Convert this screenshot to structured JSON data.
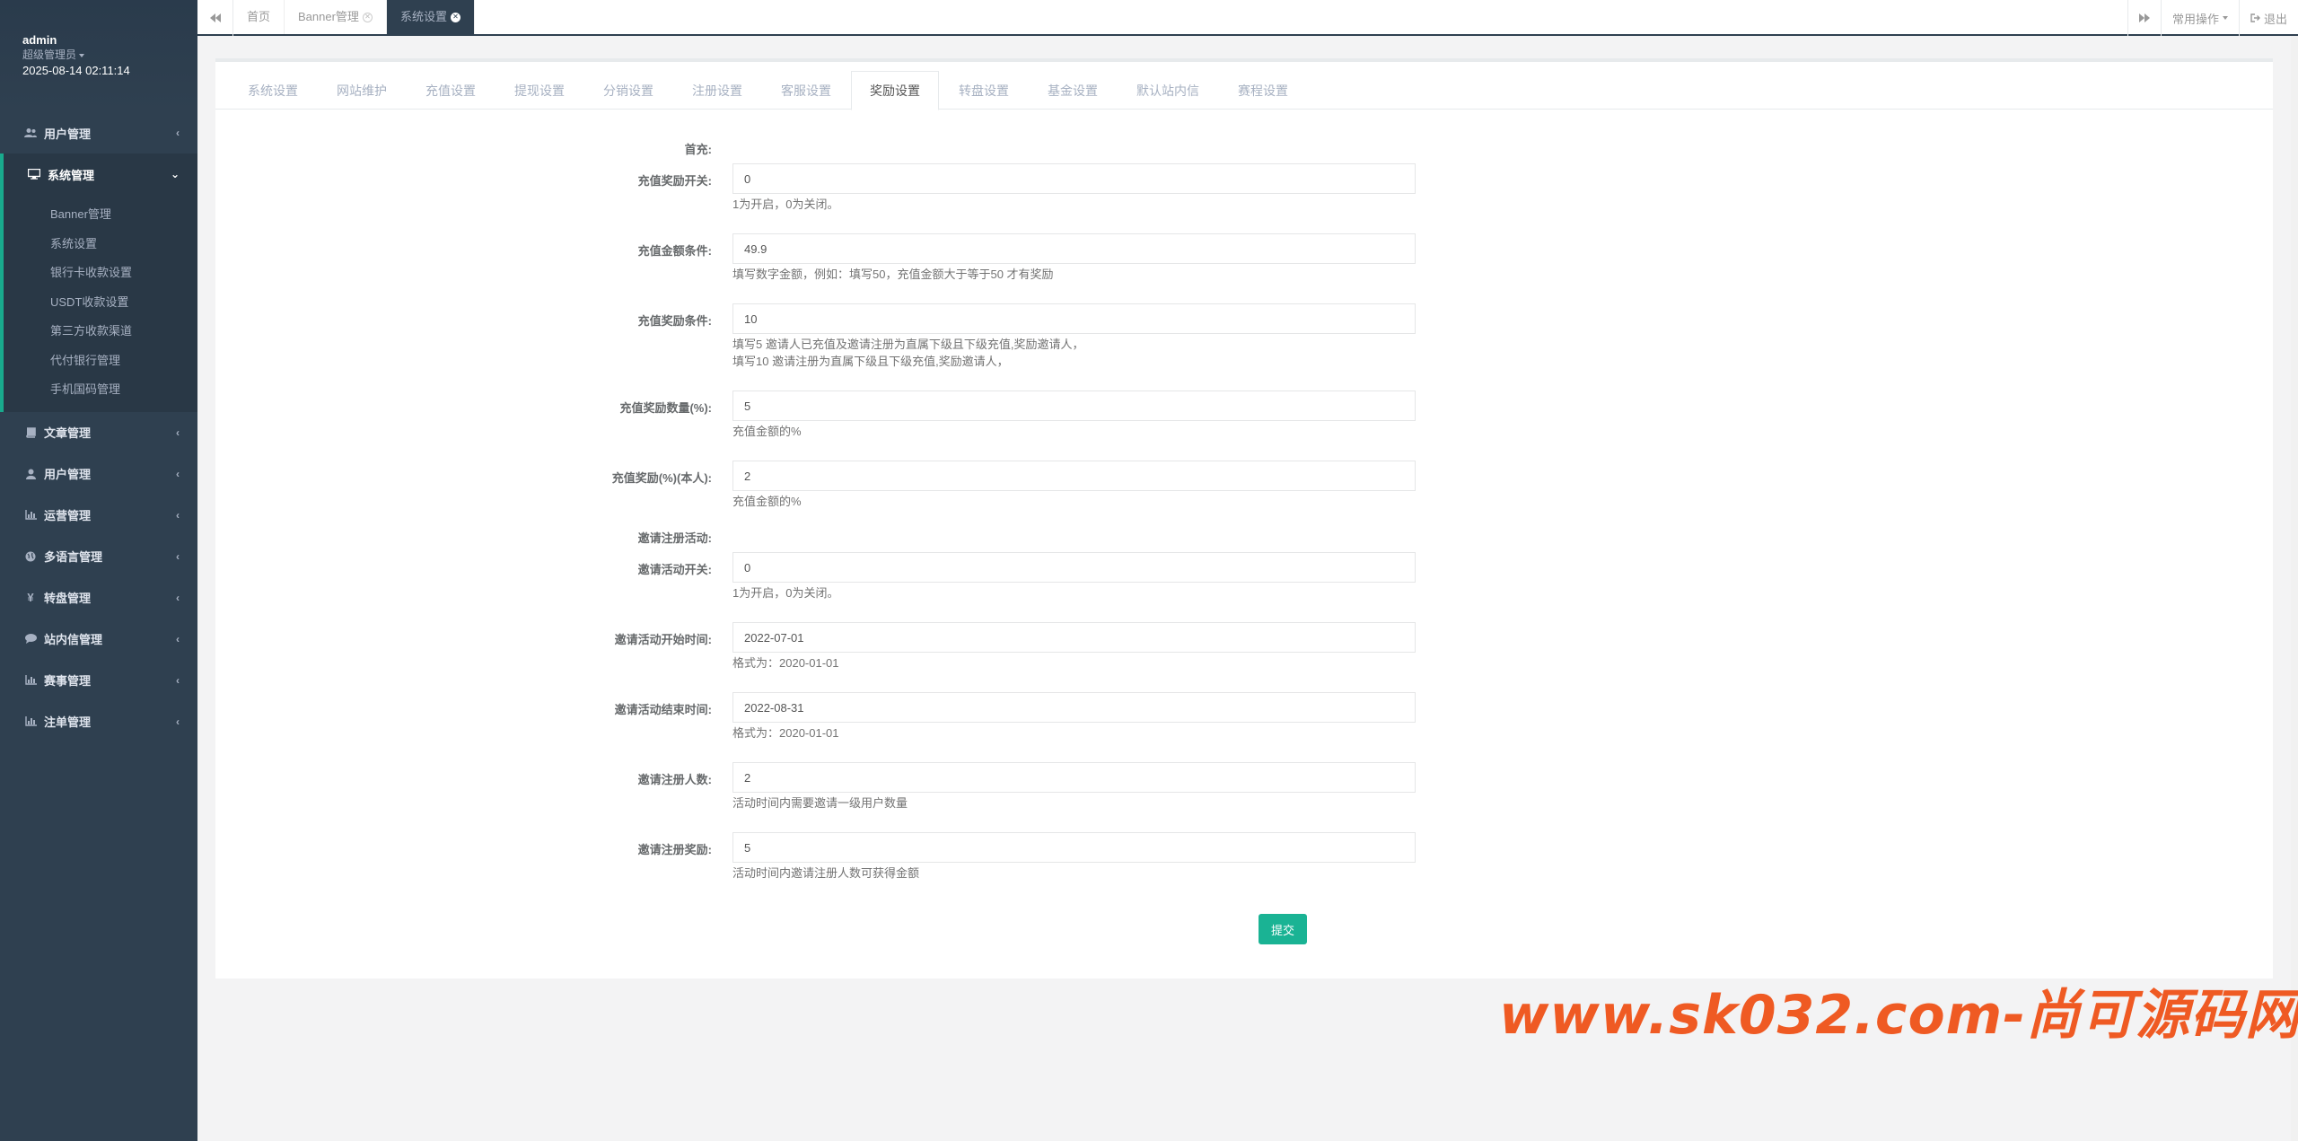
{
  "profile": {
    "name": "admin",
    "role": "超级管理员",
    "datetime": "2025-08-14 02:11:14"
  },
  "sidebar": {
    "items": [
      {
        "label": "用户管理",
        "icon": "users-icon",
        "expanded": false
      },
      {
        "label": "系统管理",
        "icon": "desktop-icon",
        "expanded": true
      },
      {
        "label": "文章管理",
        "icon": "book-icon",
        "expanded": false
      },
      {
        "label": "用户管理",
        "icon": "user-icon",
        "expanded": false
      },
      {
        "label": "运营管理",
        "icon": "bar-chart-icon",
        "expanded": false
      },
      {
        "label": "多语言管理",
        "icon": "globe-icon",
        "expanded": false
      },
      {
        "label": "转盘管理",
        "icon": "yen-icon",
        "expanded": false
      },
      {
        "label": "站内信管理",
        "icon": "comment-icon",
        "expanded": false
      },
      {
        "label": "赛事管理",
        "icon": "bar-chart-icon",
        "expanded": false
      },
      {
        "label": "注单管理",
        "icon": "bar-chart-icon",
        "expanded": false
      }
    ],
    "submenu": [
      "Banner管理",
      "系统设置",
      "银行卡收款设置",
      "USDT收款设置",
      "第三方收款渠道",
      "代付银行管理",
      "手机国码管理"
    ]
  },
  "topbar": {
    "tabs": [
      {
        "label": "首页",
        "closable": false,
        "active": false
      },
      {
        "label": "Banner管理",
        "closable": true,
        "active": false
      },
      {
        "label": "系统设置",
        "closable": true,
        "active": true
      }
    ],
    "common_ops": "常用操作",
    "logout": "退出"
  },
  "settings_tabs": [
    "系统设置",
    "网站维护",
    "充值设置",
    "提现设置",
    "分销设置",
    "注册设置",
    "客服设置",
    "奖励设置",
    "转盘设置",
    "基金设置",
    "默认站内信",
    "赛程设置"
  ],
  "active_settings_tab": "奖励设置",
  "form": {
    "section_first_recharge": "首充:",
    "fields_first": [
      {
        "label": "充值奖励开关:",
        "value": "0",
        "help": "1为开启，0为关闭。"
      },
      {
        "label": "充值金额条件:",
        "value": "49.9",
        "help": "填写数字金额，例如：填写50，充值金额大于等于50 才有奖励"
      },
      {
        "label": "充值奖励条件:",
        "value": "10",
        "help": "填写5 邀请人已充值及邀请注册为直属下级且下级充值,奖励邀请人，\n填写10 邀请注册为直属下级且下级充值,奖励邀请人，"
      },
      {
        "label": "充值奖励数量(%):",
        "value": "5",
        "help": "充值金额的%"
      },
      {
        "label": "充值奖励(%)(本人):",
        "value": "2",
        "help": "充值金额的%"
      }
    ],
    "section_invite": "邀请注册活动:",
    "fields_invite": [
      {
        "label": "邀请活动开关:",
        "value": "0",
        "help": "1为开启，0为关闭。"
      },
      {
        "label": "邀请活动开始时间:",
        "value": "2022-07-01",
        "help": "格式为：2020-01-01"
      },
      {
        "label": "邀请活动结束时间:",
        "value": "2022-08-31",
        "help": "格式为：2020-01-01"
      },
      {
        "label": "邀请注册人数:",
        "value": "2",
        "help": "活动时间内需要邀请一级用户数量"
      },
      {
        "label": "邀请注册奖励:",
        "value": "5",
        "help": "活动时间内邀请注册人数可获得金额"
      }
    ],
    "submit_label": "提交"
  },
  "watermark": "www.sk032.com-尚可源码网",
  "colors": {
    "sidebar_bg": "#2f4050",
    "accent": "#1ab394",
    "watermark": "#ef5a23"
  }
}
